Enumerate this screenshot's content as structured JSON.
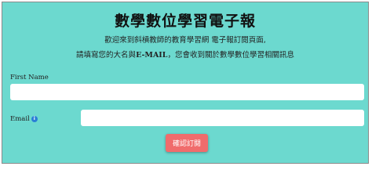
{
  "form": {
    "title": "數學數位學習電子報",
    "intro_line": "歡迎來到斜槓教師的教育學習網 電子報訂閱頁面,",
    "prompt_before": "請填寫您的大名與",
    "prompt_email": "E-MAIL",
    "prompt_after": "，您會收到關於數學數位學習相關訊息",
    "first_name_label": "First Name",
    "first_name_value": "",
    "email_label": "Email",
    "email_value": "",
    "info_icon_glyph": "i",
    "submit_label": "確認訂閱"
  },
  "colors": {
    "background": "#6cd9cf",
    "button": "#f06c6c",
    "info_icon": "#2a7fd6"
  }
}
